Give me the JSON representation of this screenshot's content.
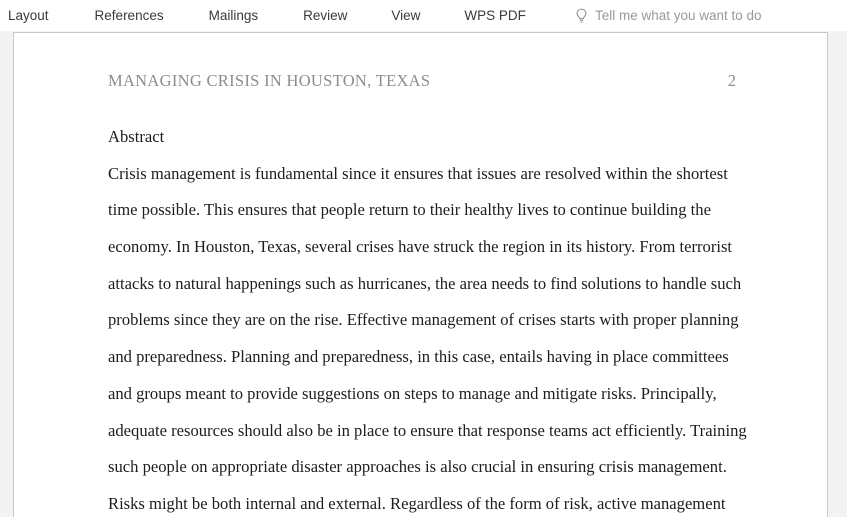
{
  "ribbon": {
    "tabs": [
      {
        "label": "Layout"
      },
      {
        "label": "References"
      },
      {
        "label": "Mailings"
      },
      {
        "label": "Review"
      },
      {
        "label": "View"
      },
      {
        "label": "WPS PDF"
      }
    ],
    "tell_me": {
      "icon": "lightbulb-icon",
      "placeholder": "Tell me what you want to do"
    }
  },
  "document": {
    "header": {
      "running_head": "MANAGING CRISIS IN HOUSTON, TEXAS",
      "page_number": "2"
    },
    "body": {
      "heading": "Abstract",
      "lines": [
        "Crisis management is fundamental since it ensures that issues are resolved within the shortest",
        "time possible. This ensures that people return to their healthy lives to continue building the",
        "economy. In Houston, Texas, several crises have struck the region in its history. From terrorist",
        "attacks to natural happenings such as hurricanes, the area needs to find solutions to handle such",
        "problems since they are on the rise. Effective management of crises starts with proper planning",
        "and preparedness. Planning and preparedness, in this case, entails having in place committees",
        "and groups meant to provide suggestions on steps to manage and mitigate risks. Principally,",
        "adequate resources should also be in place to ensure that response teams act efficiently. Training",
        "such people on appropriate disaster approaches is also crucial in ensuring crisis management.",
        "Risks might be both internal and external. Regardless of the form of risk, active management"
      ]
    }
  },
  "colors": {
    "page_background": "#ffffff",
    "canvas_background": "#f3f3f3",
    "page_border": "#c8c8cb",
    "header_text": "#8d8d8d",
    "body_text": "#1d1d1d",
    "tab_text": "#3a3a3a",
    "tellme_text": "#9a9a9a"
  }
}
